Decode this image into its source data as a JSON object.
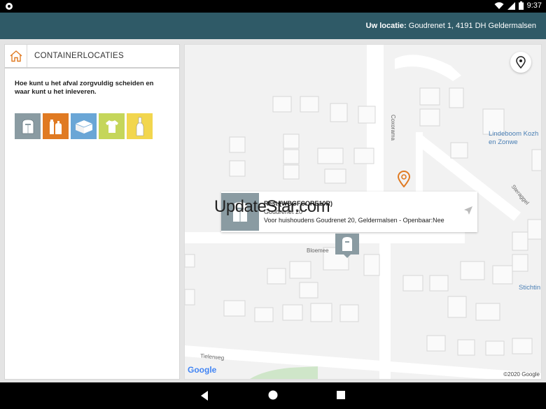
{
  "status_bar": {
    "time": "9:37",
    "icons": [
      "notification-dot-icon",
      "wifi-icon",
      "signal-icon",
      "battery-icon"
    ]
  },
  "app_bar": {
    "location_label": "Uw locatie:",
    "location_value": "Goudrenet 1, 4191 DH Geldermalsen"
  },
  "sidebar": {
    "title": "CONTAINERLOCATIES",
    "description": "Hoe kunt u het afval zorgvuldig scheiden en waar kunt u het inleveren.",
    "categories": [
      {
        "name": "restafval",
        "color": "#8a9ba2"
      },
      {
        "name": "plastic",
        "color": "#e07a22"
      },
      {
        "name": "papier",
        "color": "#6aa6d6"
      },
      {
        "name": "textiel",
        "color": "#c5d65a"
      },
      {
        "name": "glas",
        "color": "#f2d64e"
      }
    ]
  },
  "map": {
    "streets": [
      "Coxorama",
      "Bloemee",
      "Tielerweg",
      "Steraggel"
    ],
    "places": [
      "Lindeboom Kozh en Zonwe",
      "Stichtin"
    ],
    "infowindow": {
      "title": "Rest (WBGFCORE10R)",
      "address": "Goudrenet 20",
      "details": "Voor huishoudens Goudrenet 20, Geldermalsen - Openbaar:Nee"
    },
    "watermark": "UpdateStar.com",
    "google_logo": "Google",
    "copyright": "©2020 Google"
  },
  "colors": {
    "app_bar": "#2f5a67",
    "marker_orange": "#e07a22",
    "marker_grey": "#8a9ba2"
  }
}
